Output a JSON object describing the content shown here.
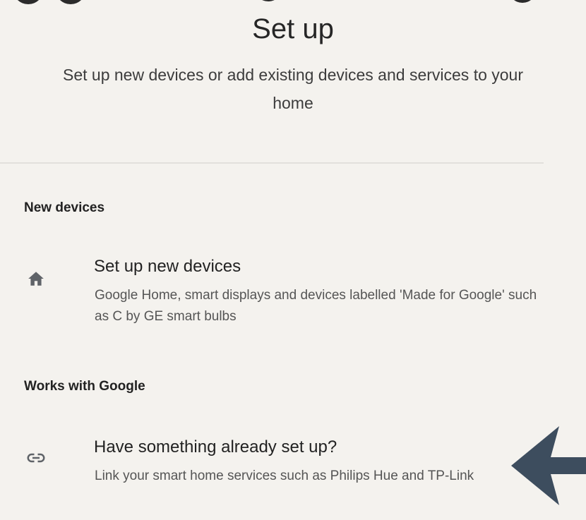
{
  "header": {
    "title": "Set up",
    "subtitle": "Set up new devices or add existing devices and services to your home"
  },
  "sections": [
    {
      "label": "New devices",
      "item": {
        "icon": "home-icon",
        "title": "Set up new devices",
        "description": "Google Home, smart displays and devices labelled 'Made for Google' such as C by GE smart bulbs"
      }
    },
    {
      "label": "Works with Google",
      "item": {
        "icon": "link-icon",
        "title": "Have something already set up?",
        "description": "Link your smart home services such as Philips Hue and TP-Link"
      }
    }
  ],
  "annotation": {
    "icon": "arrow-left-icon",
    "color": "#3d4d5e"
  },
  "colors": {
    "background": "#f4f2ee",
    "icon": "#5f6368"
  }
}
